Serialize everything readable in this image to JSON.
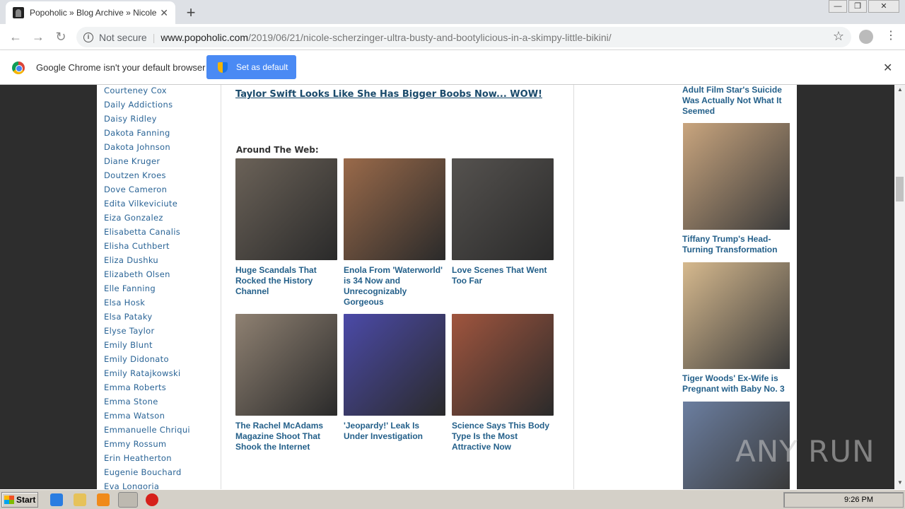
{
  "browser": {
    "tab_title": "Popoholic » Blog Archive » Nicole Scherzinger",
    "security_label": "Not secure",
    "url_host": "www.popoholic.com",
    "url_path": "/2019/06/21/nicole-scherzinger-ultra-busty-and-bootylicious-in-a-skimpy-little-bikini/"
  },
  "infobar": {
    "message": "Google Chrome isn't your default browser",
    "button_label": "Set as default"
  },
  "sidebar_left": {
    "items": [
      "Courteney Cox",
      "Daily Addictions",
      "Daisy Ridley",
      "Dakota Fanning",
      "Dakota Johnson",
      "Diane Kruger",
      "Doutzen Kroes",
      "Dove Cameron",
      "Edita Vilkeviciute",
      "Eiza Gonzalez",
      "Elisabetta Canalis",
      "Elisha Cuthbert",
      "Eliza Dushku",
      "Elizabeth Olsen",
      "Elle Fanning",
      "Elsa Hosk",
      "Elsa Pataky",
      "Elyse Taylor",
      "Emily Blunt",
      "Emily Didonato",
      "Emily Ratajkowski",
      "Emma Roberts",
      "Emma Stone",
      "Emma Watson",
      "Emmanuelle Chriqui",
      "Emmy Rossum",
      "Erin Heatherton",
      "Eugenie Bouchard",
      "Eva Longoria"
    ]
  },
  "main": {
    "top_link": "Taylor Swift Looks Like She Has Bigger Boobs Now... WOW!",
    "around_heading": "Around The Web:",
    "cards": [
      {
        "caption": "Huge Scandals That Rocked the History Channel",
        "color": "#6b6258"
      },
      {
        "caption": "Enola From 'Waterworld' is 34 Now and Unrecognizably Gorgeous",
        "color": "#9a6a4a"
      },
      {
        "caption": "Love Scenes That Went Too Far",
        "color": "#55524f"
      },
      {
        "caption": "The Rachel McAdams Magazine Shoot That Shook the Internet",
        "color": "#8f8172"
      },
      {
        "caption": "'Jeopardy!' Leak Is Under Investigation",
        "color": "#4b4aa8"
      },
      {
        "caption": "Science Says This Body Type Is the Most Attractive Now",
        "color": "#a0553e"
      }
    ]
  },
  "sidebar_right": {
    "items": [
      {
        "caption": "Adult Film Star's Suicide Was Actually Not What It Seemed"
      },
      {
        "caption": "Tiffany Trump's Head-Turning Transformation",
        "color": "#c9a57e"
      },
      {
        "caption": "Tiger Woods' Ex-Wife is Pregnant with Baby No. 3",
        "color": "#d6b98e"
      },
      {
        "caption": "",
        "color": "#6b7ea0"
      }
    ]
  },
  "watermark": "ANY RUN",
  "taskbar": {
    "start_label": "Start",
    "clock": "9:26 PM"
  }
}
